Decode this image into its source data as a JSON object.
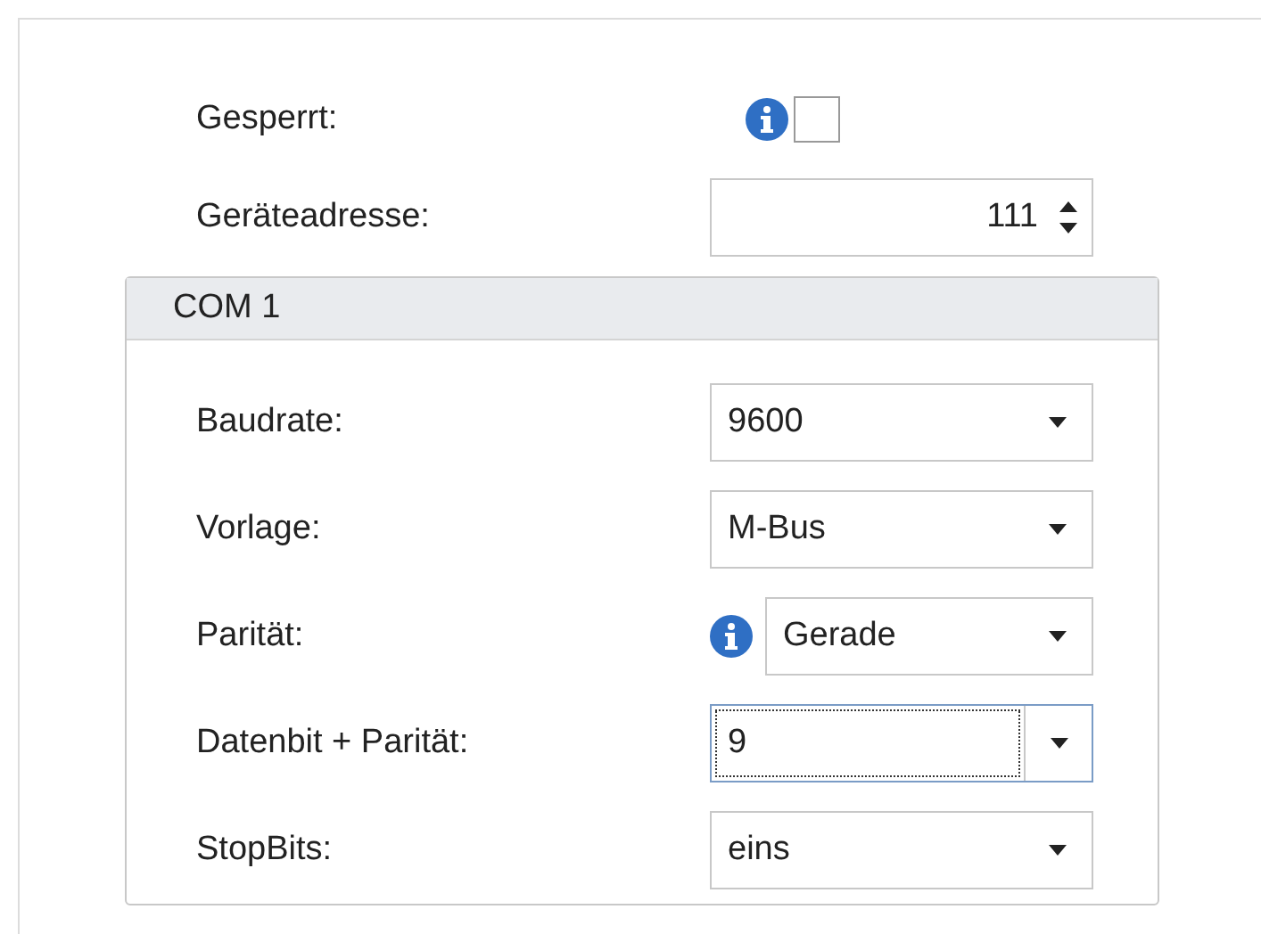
{
  "fields": [
    {
      "kind": "checkbox",
      "label": "Gesperrt:",
      "info": true,
      "checked": false
    },
    {
      "kind": "spin",
      "label": "Geräteadresse:",
      "value": "111"
    }
  ],
  "group": {
    "title": "COM 1",
    "rows": [
      {
        "label": "Baudrate:",
        "value": "9600",
        "info": false,
        "focused": false
      },
      {
        "label": "Vorlage:",
        "value": "M-Bus",
        "info": false,
        "focused": false
      },
      {
        "label": "Parität:",
        "value": "Gerade",
        "info": true,
        "focused": false
      },
      {
        "label": "Datenbit + Parität:",
        "value": "9",
        "info": false,
        "focused": true
      },
      {
        "label": "StopBits:",
        "value": "eins",
        "info": false,
        "focused": false
      }
    ]
  }
}
